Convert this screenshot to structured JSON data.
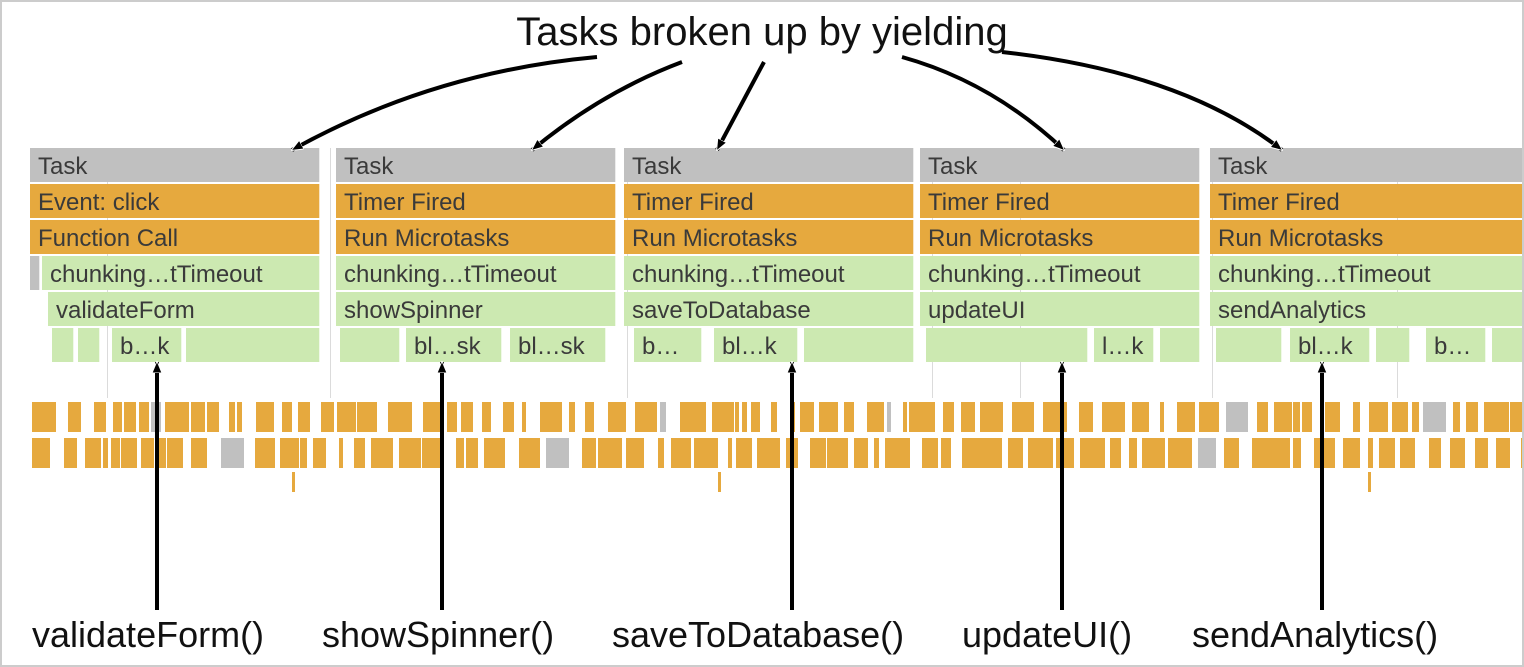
{
  "title": "Tasks broken up by yielding",
  "colors": {
    "gray": "#c0c0c0",
    "orange": "#e6a93e",
    "green": "#cce9b1"
  },
  "columns": [
    {
      "task": "Task",
      "event": "Event: click",
      "call": "Function Call",
      "chunk": "chunking…tTimeout",
      "fn": "validateForm",
      "frags": [
        "b…k"
      ]
    },
    {
      "task": "Task",
      "event": "Timer Fired",
      "call": "Run Microtasks",
      "chunk": "chunking…tTimeout",
      "fn": "showSpinner",
      "frags": [
        "bl…sk",
        "bl…sk"
      ]
    },
    {
      "task": "Task",
      "event": "Timer Fired",
      "call": "Run Microtasks",
      "chunk": "chunking…tTimeout",
      "fn": "saveToDatabase",
      "frags": [
        "b…",
        "bl…k"
      ]
    },
    {
      "task": "Task",
      "event": "Timer Fired",
      "call": "Run Microtasks",
      "chunk": "chunking…tTimeout",
      "fn": "updateUI",
      "frags": [
        "l…k"
      ]
    },
    {
      "task": "Task",
      "event": "Timer Fired",
      "call": "Run Microtasks",
      "chunk": "chunking…tTimeout",
      "fn": "sendAnalytics",
      "frags": [
        "bl…k",
        "b…"
      ]
    }
  ],
  "bottomLabels": [
    "validateForm()",
    "showSpinner()",
    "saveToDatabase()",
    "updateUI()",
    "sendAnalytics()"
  ]
}
